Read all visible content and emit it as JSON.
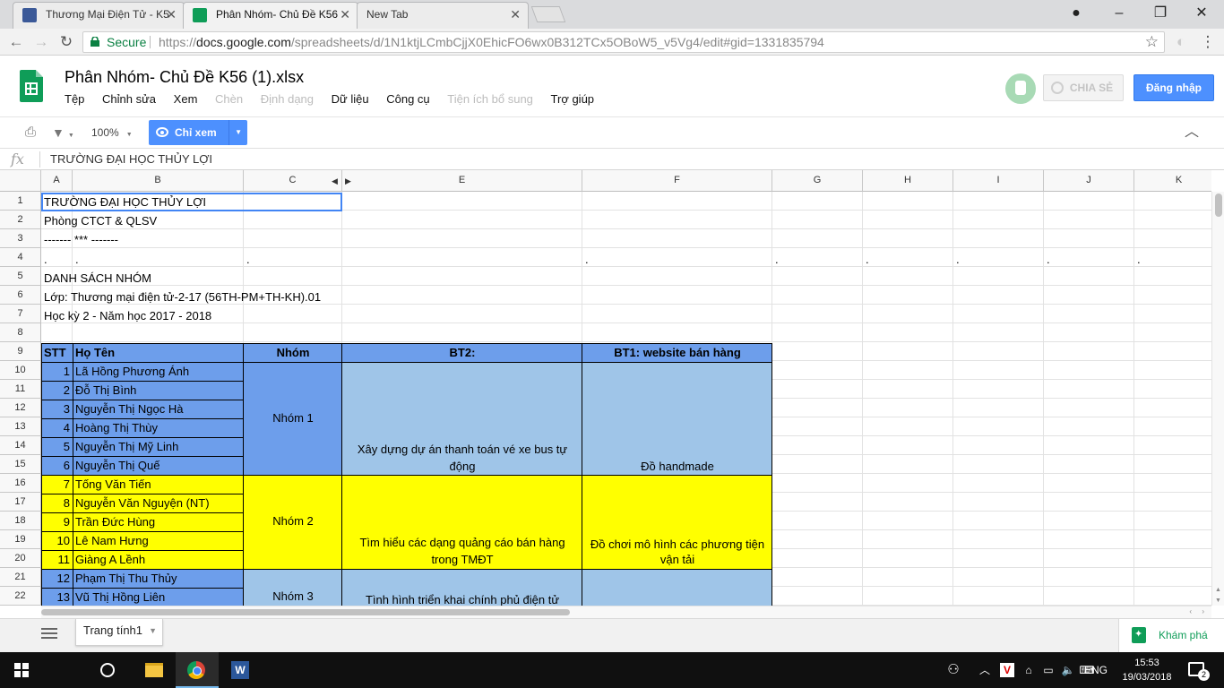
{
  "browser": {
    "tabs": [
      {
        "title": "Thương Mại Điện Tử - K5",
        "icon": "facebook-icon"
      },
      {
        "title": "Phân Nhóm- Chủ Đề K56",
        "icon": "sheets-icon"
      },
      {
        "title": "New Tab",
        "icon": ""
      }
    ],
    "secure_label": "Secure",
    "url_scheme": "https://",
    "url_host": "docs.google.com",
    "url_path": "/spreadsheets/d/1N1ktjLCmbCjjX0EhicFO6wx0B312TCx5OBoW5_v5Vg4/edit#gid=1331835794"
  },
  "doc": {
    "title": "Phân Nhóm- Chủ Đề K56 (1).xlsx",
    "menus": [
      {
        "label": "Tệp",
        "enabled": true
      },
      {
        "label": "Chỉnh sửa",
        "enabled": true
      },
      {
        "label": "Xem",
        "enabled": true
      },
      {
        "label": "Chèn",
        "enabled": false
      },
      {
        "label": "Định dạng",
        "enabled": false
      },
      {
        "label": "Dữ liệu",
        "enabled": true
      },
      {
        "label": "Công cụ",
        "enabled": true
      },
      {
        "label": "Tiện ích bổ sung",
        "enabled": false
      },
      {
        "label": "Trợ giúp",
        "enabled": true
      }
    ],
    "share_label": "CHIA SẺ",
    "login_label": "Đăng nhập"
  },
  "toolbar": {
    "zoom": "100%",
    "view_only_label": "Chỉ xem"
  },
  "formula": {
    "fx": "fx",
    "value": "TRƯỜNG ĐẠI HỌC THỦY LỢI"
  },
  "grid": {
    "columns": [
      "A",
      "B",
      "C",
      "E",
      "F",
      "G",
      "H",
      "I",
      "J",
      "K"
    ],
    "rows": [
      "1",
      "2",
      "3",
      "4",
      "5",
      "6",
      "7",
      "8",
      "9",
      "10",
      "11",
      "12",
      "13",
      "14",
      "15",
      "16",
      "17",
      "18",
      "19",
      "20",
      "21",
      "22"
    ],
    "header_info": {
      "r1": "TRƯỜNG ĐẠI HỌC THỦY LỢI",
      "r2": "Phòng CTCT & QLSV",
      "r3": "------- *** -------",
      "r5": "DANH SÁCH NHÓM",
      "r6": "Lớp: Thương mại điện tử-2-17 (56TH-PM+TH-KH).01",
      "r7": "Học kỳ 2 - Năm học 2017 - 2018"
    },
    "dot": ".",
    "table_headers": {
      "stt": "STT",
      "name": "Họ Tên",
      "group": "Nhóm",
      "bt2": "BT2:",
      "bt1": "BT1: website bán hàng"
    },
    "students": [
      {
        "stt": "1",
        "name": "Lã Hồng Phương Ánh"
      },
      {
        "stt": "2",
        "name": "Đỗ Thị Bình"
      },
      {
        "stt": "3",
        "name": "Nguyễn Thị Ngọc Hà"
      },
      {
        "stt": "4",
        "name": "Hoàng Thị Thùy"
      },
      {
        "stt": "5",
        "name": "Nguyễn Thị Mỹ Linh"
      },
      {
        "stt": "6",
        "name": "Nguyễn Thị Quế"
      },
      {
        "stt": "7",
        "name": "Tống Văn Tiến"
      },
      {
        "stt": "8",
        "name": "Nguyễn Văn Nguyện (NT)"
      },
      {
        "stt": "9",
        "name": "Trần Đức Hùng"
      },
      {
        "stt": "10",
        "name": "Lê Nam Hưng"
      },
      {
        "stt": "11",
        "name": "Giàng A Lềnh"
      },
      {
        "stt": "12",
        "name": "Phạm Thị Thu Thủy"
      },
      {
        "stt": "13",
        "name": "Vũ Thị Hồng Liên"
      }
    ],
    "groups": [
      {
        "name": "Nhóm 1",
        "bt2": "Xây dựng dự án thanh toán vé xe bus tự động",
        "bt1": "Đồ handmade",
        "color": "#6d9eeb"
      },
      {
        "name": "Nhóm 2",
        "bt2": "Tìm hiểu các dạng quảng cáo bán hàng trong TMĐT",
        "bt1": "Đồ chơi mô hình các phương tiện vận tải",
        "color": "#ffff00"
      },
      {
        "name": "Nhóm 3",
        "bt2": "Tình hình triển khai chính phủ điện tử",
        "bt1": "",
        "color": "#9fc5e8"
      }
    ]
  },
  "sheets": {
    "active": "Trang tính1",
    "explore_label": "Khám phá"
  },
  "taskbar": {
    "language": "ENG",
    "time": "15:53",
    "date": "19/03/2018",
    "notifications": "2"
  }
}
